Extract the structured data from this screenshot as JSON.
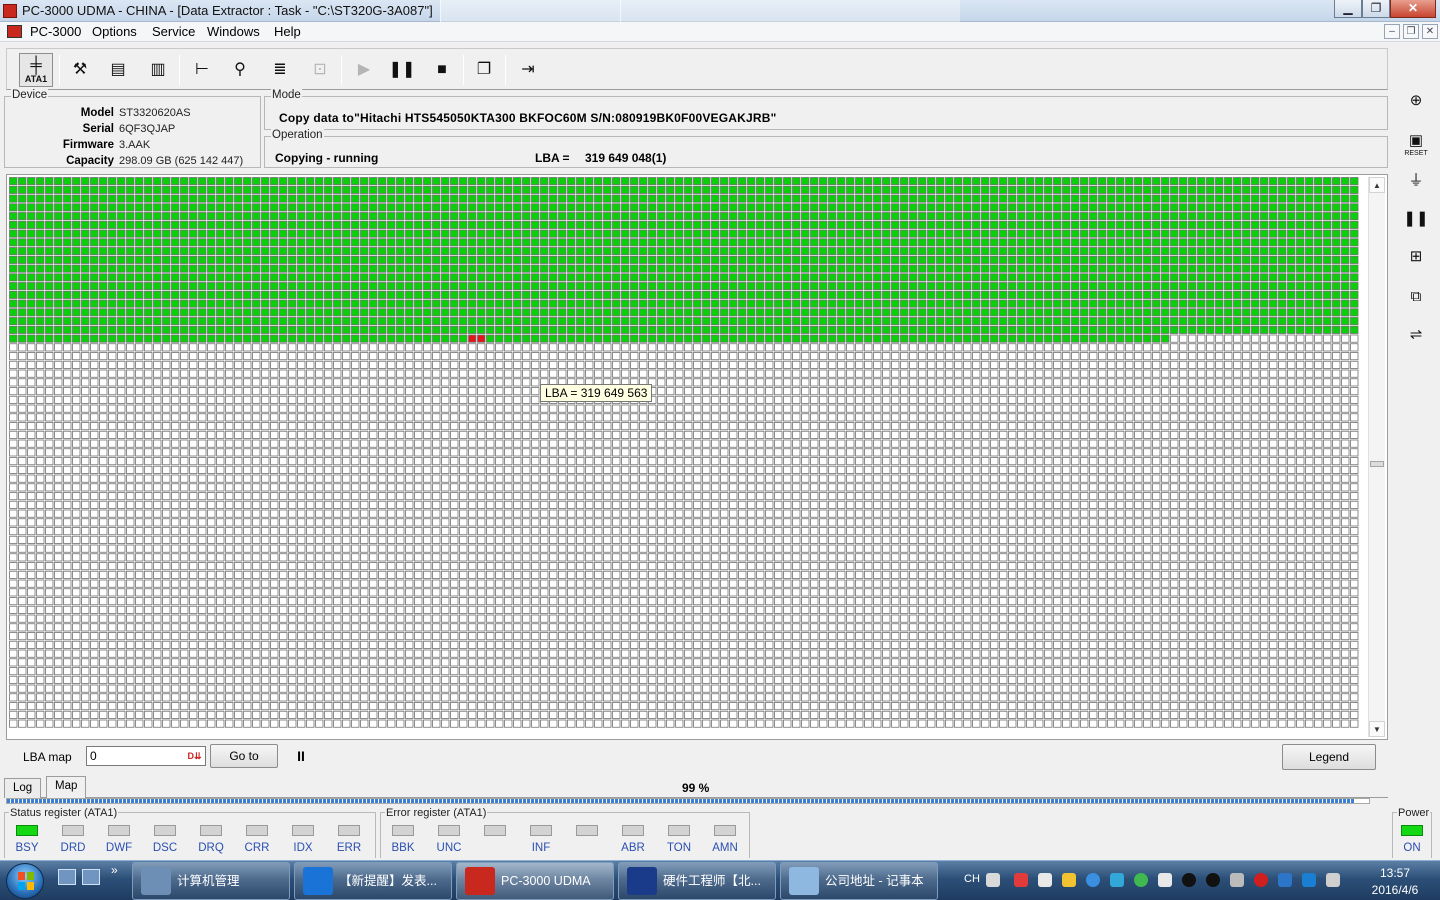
{
  "window": {
    "title": "PC-3000 UDMA - CHINA - [Data Extractor : Task - \"C:\\ST320G-3A087\"]",
    "buttons": [
      "▁",
      "❐",
      "✕"
    ]
  },
  "menubar": {
    "items": [
      "PC-3000",
      "Options",
      "Service",
      "Windows",
      "Help"
    ],
    "mdi_buttons": [
      "–",
      "❐",
      "✕"
    ]
  },
  "toolbar": {
    "ata1_label": "ATA1",
    "icons": [
      "port-icon",
      "tools-icon",
      "drive-info-icon",
      "percent-icon",
      "tree-icon",
      "binoculars-icon",
      "layers-icon",
      "tape-icon",
      "play-icon",
      "pause-icon",
      "stop-icon",
      "copy-icon",
      "exit-icon"
    ]
  },
  "device": {
    "legend": "Device",
    "rows": [
      {
        "label": "Model",
        "value": "ST3320620AS"
      },
      {
        "label": "Serial",
        "value": "6QF3QJAP"
      },
      {
        "label": "Firmware",
        "value": "3.AAK"
      },
      {
        "label": "Capacity",
        "value": "298.09 GB (625 142 447)"
      }
    ]
  },
  "mode": {
    "legend": "Mode",
    "text": "Copy data to\"Hitachi HTS545050KTA300 BKFOC60M S/N:080919BK0F00VEGAKJRB\""
  },
  "operation": {
    "legend": "Operation",
    "status": "Copying - running",
    "lba_label": "LBA =",
    "lba_value": "319 649 048(1)"
  },
  "map": {
    "tooltip": "LBA =   319 649 563",
    "colors": {
      "done": "#0bcf0b",
      "error": "#e0161c",
      "pending": "#ffffff",
      "grid": "#707070"
    },
    "rows": 63,
    "cols": 150,
    "complete_rows": 19,
    "last_row_complete_cols": 129,
    "error_cells": [
      {
        "row": 18,
        "col": 51
      },
      {
        "row": 18,
        "col": 52
      }
    ]
  },
  "mapctl": {
    "label": "LBA map",
    "input_value": "0",
    "spin_label": "D⇊",
    "goto_label": "Go to",
    "pause_label": "II",
    "legend_label": "Legend"
  },
  "tabs": [
    "Log",
    "Map"
  ],
  "progress": {
    "percent_text": "99 %",
    "value": 99
  },
  "status_register": {
    "legend": "Status register (ATA1)",
    "leds": [
      {
        "label": "BSY",
        "on": true
      },
      {
        "label": "DRD",
        "on": false
      },
      {
        "label": "DWF",
        "on": false
      },
      {
        "label": "DSC",
        "on": false
      },
      {
        "label": "DRQ",
        "on": false
      },
      {
        "label": "CRR",
        "on": false
      },
      {
        "label": "IDX",
        "on": false
      },
      {
        "label": "ERR",
        "on": false
      }
    ]
  },
  "error_register": {
    "legend": "Error register (ATA1)",
    "leds": [
      {
        "label": "BBK",
        "on": false
      },
      {
        "label": "UNC",
        "on": false
      },
      {
        "label": "",
        "on": false
      },
      {
        "label": "INF",
        "on": false
      },
      {
        "label": "",
        "on": false
      },
      {
        "label": "ABR",
        "on": false
      },
      {
        "label": "TON",
        "on": false
      },
      {
        "label": "AMN",
        "on": false
      }
    ]
  },
  "power": {
    "legend": "Power",
    "label": "ON",
    "on": true
  },
  "sidebar": {
    "icons": [
      "zero-fill-icon",
      "reset-icon",
      "power-switch-icon",
      "pause-icon",
      "counter-icon",
      "duplicate-icon",
      "connector-icon"
    ],
    "reset_label": "RESET"
  },
  "taskbar": {
    "items": [
      {
        "label": "计算机管理",
        "color": "#6d8fb6"
      },
      {
        "label": "【新提醒】发表...",
        "color": "#1a73d6"
      },
      {
        "label": "PC-3000 UDMA",
        "color": "#c8281e",
        "active": true
      },
      {
        "label": "硬件工程师【北...",
        "color": "#1a3a8a"
      },
      {
        "label": "公司地址 - 记事本",
        "color": "#8fb8e0"
      }
    ],
    "lang": "CH",
    "clock_time": "13:57",
    "clock_date": "2016/4/6"
  }
}
